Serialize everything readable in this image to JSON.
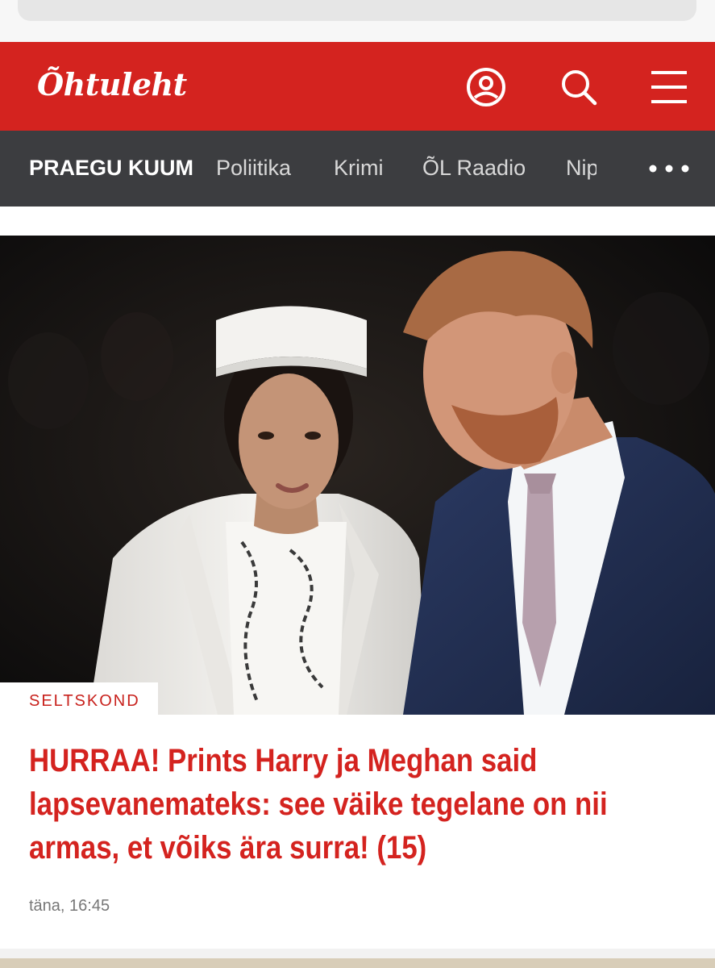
{
  "header": {
    "logo_text": "Õhtuleht",
    "brand_color": "#d4231f",
    "icons": [
      "user-icon",
      "search-icon",
      "menu-icon"
    ]
  },
  "nav": {
    "items": [
      {
        "label": "PRAEGU KUUM",
        "active": true
      },
      {
        "label": "Poliitika",
        "active": false
      },
      {
        "label": "Krimi",
        "active": false
      },
      {
        "label": "ÕL Raadio",
        "active": false
      },
      {
        "label": "Nip",
        "active": false
      }
    ],
    "more_icon": "more-dots-icon"
  },
  "article": {
    "category": "SELTSKOND",
    "headline": "HURRAA! Prints Harry ja Meghan said lapsevanemateks: see väike tegelane on nii armas, et võiks ära surra! (15)",
    "timestamp": "täna, 16:45"
  }
}
